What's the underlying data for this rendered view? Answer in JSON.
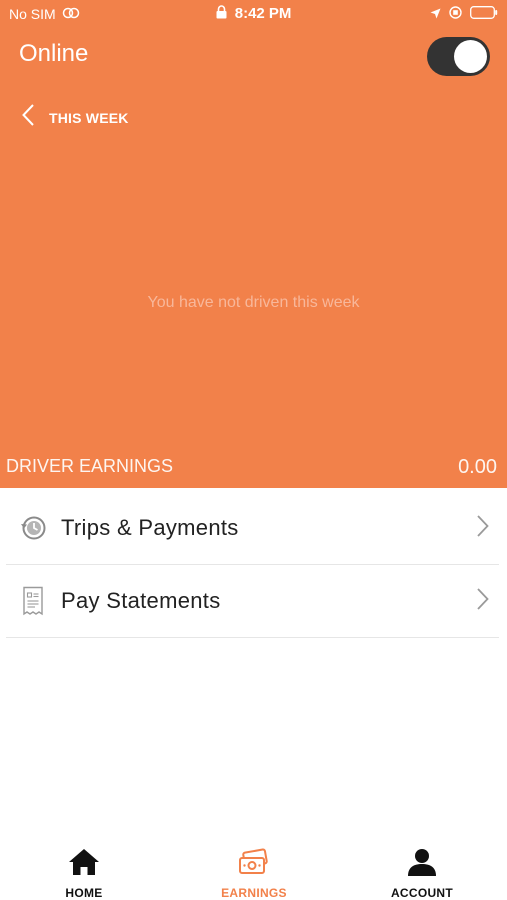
{
  "status_bar": {
    "carrier": "No SIM",
    "time": "8:42 PM"
  },
  "header": {
    "title": "Online",
    "toggle_on": true
  },
  "period": {
    "label": "THIS WEEK"
  },
  "chart": {
    "empty_message": "You have not driven this week"
  },
  "earnings": {
    "label": "DRIVER EARNINGS",
    "value": "0.00"
  },
  "menu": [
    {
      "label": "Trips & Payments",
      "icon": "history-icon"
    },
    {
      "label": "Pay Statements",
      "icon": "statement-icon"
    }
  ],
  "nav": {
    "items": [
      {
        "label": "HOME",
        "icon": "home-icon",
        "active": false
      },
      {
        "label": "EARNINGS",
        "icon": "earnings-icon",
        "active": true
      },
      {
        "label": "ACCOUNT",
        "icon": "account-icon",
        "active": false
      }
    ]
  },
  "colors": {
    "brand": "#F2814A",
    "active_nav": "#F2814A",
    "text": "#222222"
  }
}
